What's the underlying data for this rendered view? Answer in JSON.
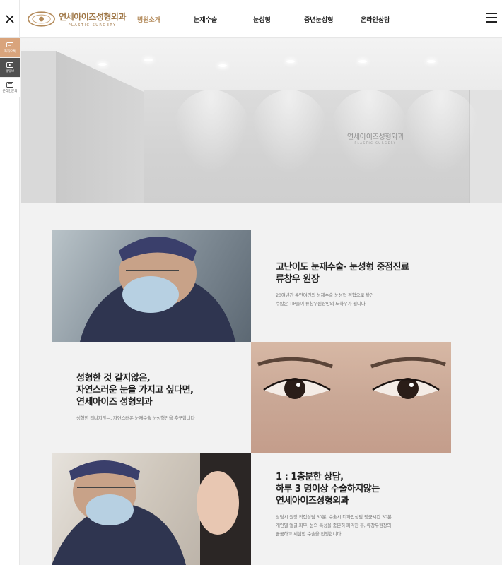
{
  "header": {
    "logo": {
      "text_ko": "연세아이즈성형외과",
      "text_en": "PLASTIC SURGERY",
      "color": "#a07848"
    },
    "nav": [
      {
        "label": "병원소개",
        "active": true
      },
      {
        "label": "눈재수술",
        "active": false
      },
      {
        "label": "눈성형",
        "active": false
      },
      {
        "label": "중년눈성형",
        "active": false
      },
      {
        "label": "온라인상담",
        "active": false
      }
    ],
    "accent_color": "#b38a5a",
    "close_icon": "close-icon",
    "menu_icon": "hamburger-menu-icon"
  },
  "quick_menu": [
    {
      "label": "카카오톡",
      "icon": "chat-icon",
      "bg": "#d9a47c"
    },
    {
      "label": "유튜브",
      "icon": "play-icon",
      "bg": "#505050"
    },
    {
      "label": "온라인문의",
      "icon": "message-icon",
      "bg": "#ffffff"
    }
  ],
  "hero": {
    "sign_ko": "연세아이즈성형외과",
    "sign_en": "PLASTIC SURGERY"
  },
  "sections": [
    {
      "title_lines": [
        "고난이도 눈재수술· 눈성형 중점진료",
        "류창우 원장"
      ],
      "desc_lines": [
        "20여년간 수만여건의 눈재수술 눈성형 경험으로 쌓인",
        "수많은 TIP들이 류창우원장만의 노하우가 됩니다"
      ]
    },
    {
      "title_lines": [
        "성형한 것 같지않은,",
        "자연스러운 눈을 가지고 싶다면,",
        "연세아이즈 성형외과"
      ],
      "desc_lines": [
        "성형한 티나지않는, 자연스러운 눈재수술 눈성형만을 추구합니다"
      ]
    },
    {
      "title_lines": [
        "1 : 1충분한 상담,",
        "하루 3 명이상 수술하지않는",
        "연세아이즈성형외과"
      ],
      "desc_lines": [
        "상담시 원장 직접상담 30분, 수술시 디자인상담 평균시간 30분",
        "개인별 얼굴,피부, 눈의 특성을 충분히 파악한 후, 류창우원장의",
        "꼼꼼하고 세심한 수술을 진행합니다."
      ]
    }
  ]
}
